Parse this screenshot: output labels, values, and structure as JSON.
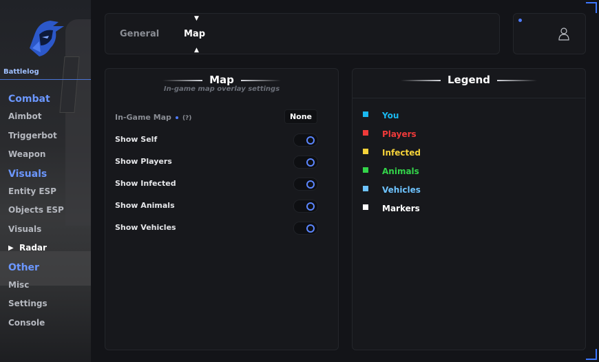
{
  "brand": {
    "name": "Battlelog"
  },
  "nav": {
    "sections": [
      {
        "label": "Combat",
        "items": [
          "Aimbot",
          "Triggerbot",
          "Weapon"
        ]
      },
      {
        "label": "Visuals",
        "items": [
          "Entity ESP",
          "Objects ESP",
          "Visuals",
          "Radar"
        ]
      },
      {
        "label": "Other",
        "items": [
          "Misc",
          "Settings",
          "Console"
        ]
      }
    ],
    "active_item": "Radar"
  },
  "tabs": {
    "general": "General",
    "map": "Map",
    "active": "Map"
  },
  "map_panel": {
    "title": "Map",
    "subtitle": "In-game map overlay settings",
    "ingame_map": {
      "label": "In-Game Map",
      "help": "(?)",
      "value": "None"
    },
    "toggles": [
      {
        "label": "Show Self",
        "on": true
      },
      {
        "label": "Show Players",
        "on": true
      },
      {
        "label": "Show Infected",
        "on": true
      },
      {
        "label": "Show Animals",
        "on": true
      },
      {
        "label": "Show Vehicles",
        "on": true
      }
    ]
  },
  "legend_panel": {
    "title": "Legend",
    "items": [
      {
        "label": "You",
        "color": "#1ab8f0"
      },
      {
        "label": "Players",
        "color": "#f03a3a"
      },
      {
        "label": "Infected",
        "color": "#f5d23a"
      },
      {
        "label": "Animals",
        "color": "#33d44a"
      },
      {
        "label": "Vehicles",
        "color": "#6ec3ff"
      },
      {
        "label": "Markers",
        "color": "#ffffff"
      }
    ]
  },
  "colors": {
    "accent": "#4f7cff"
  }
}
